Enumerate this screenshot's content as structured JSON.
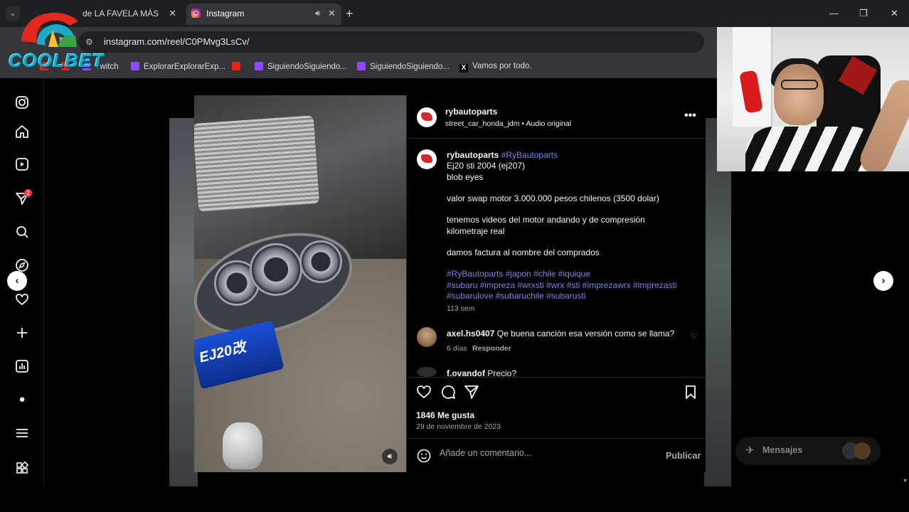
{
  "browser": {
    "tabs": [
      {
        "title": "de LA FAVELA MÁS GR",
        "active": false
      },
      {
        "title": "Instagram",
        "active": true
      }
    ],
    "url": "instagram.com/reel/C0PMvg3LsCv/",
    "bookmarks": [
      {
        "label": "Twitch",
        "icon": "twitch-icon"
      },
      {
        "label": "ExplorarExplorarExp...",
        "icon": "twitch-icon"
      },
      {
        "label": "SiguiendoSiguiendo...",
        "icon": "twitch-icon"
      },
      {
        "label": "SiguiendoSiguiendo...",
        "icon": "twitch-icon"
      },
      {
        "label": "Vamos por todo.",
        "icon": "x-icon"
      }
    ]
  },
  "overlay": {
    "logo_text": "COOLBET"
  },
  "nav": {
    "notification_count": "2",
    "items": [
      "instagram-logo-icon",
      "home-icon",
      "reels-icon",
      "direct-icon",
      "search-icon",
      "explore-icon",
      "notifications-icon",
      "create-icon",
      "dashboard-icon",
      "profile-icon",
      "menu-icon",
      "more-icon"
    ]
  },
  "post": {
    "author": "rybautoparts",
    "audio_account": "street_car_honda_jdm",
    "audio_sep": "•",
    "audio_label": "Audio original",
    "caption": {
      "author": "rybautoparts",
      "tag": "#RyBautoparts",
      "lines": [
        "Ej20 sti 2004 (ej207)",
        "blob eyes",
        "valor swap motor 3.000.000 pesos chilenos (3500 dolar)",
        "tenemos videos del motor andando y de compresión",
        "kilometraje real",
        "damos factura al nombre del comprados"
      ],
      "hashtags": [
        "#RyBautoparts #japon #chile #iquique",
        "#subaru #impreza #wrxsti #wrx #sti #imprezawrx #imprezasti",
        "#subarulove #subaruchile #subarusti"
      ],
      "time": "113 sem"
    },
    "comments": [
      {
        "user": "axel.hs0407",
        "text": "Qe buena canción esa versión como se llama?",
        "time": "6 días",
        "reply": "Responder"
      },
      {
        "user": "f.ovandof",
        "text": "Precio?"
      }
    ],
    "likes": "1846 Me gusta",
    "date": "29 de noviembre de 2023",
    "comment_placeholder": "Añade un comentario...",
    "publish_label": "Publicar",
    "media_label": "EJ20改"
  },
  "messages": {
    "label": "Mensajes",
    "badge": "2"
  }
}
